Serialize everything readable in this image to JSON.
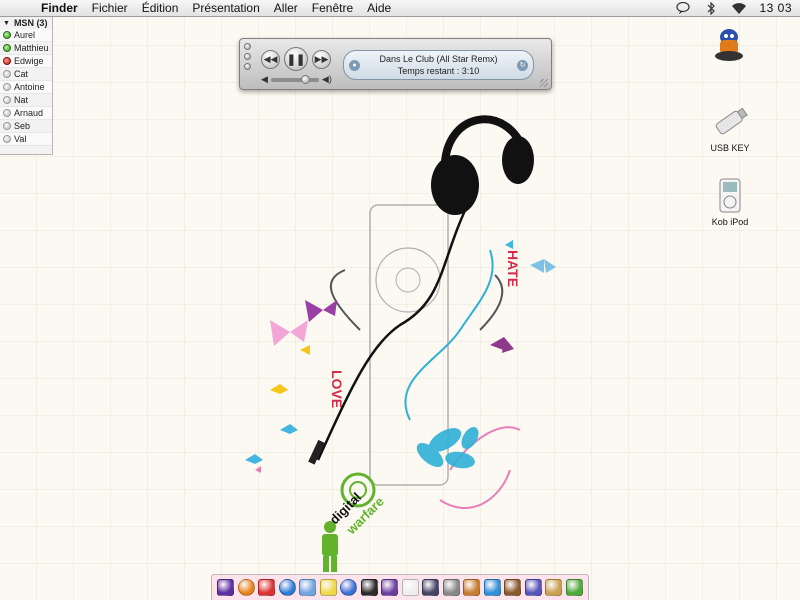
{
  "menubar": {
    "apple_glyph": "",
    "app_name": "Finder",
    "menus": [
      "Fichier",
      "Édition",
      "Présentation",
      "Aller",
      "Fenêtre",
      "Aide"
    ],
    "clock": "13 03",
    "status_icons": [
      "ichat-icon",
      "bluetooth-icon",
      "wifi-icon"
    ]
  },
  "msn": {
    "header": "MSN (3)",
    "contacts": [
      {
        "name": "Aurel",
        "status": "online"
      },
      {
        "name": "Matthieu",
        "status": "online"
      },
      {
        "name": "Edwige",
        "status": "busy"
      },
      {
        "name": "Cat",
        "status": "offline"
      },
      {
        "name": "Antoine",
        "status": "offline"
      },
      {
        "name": "Nat",
        "status": "offline"
      },
      {
        "name": "Arnaud",
        "status": "offline"
      },
      {
        "name": "Seb",
        "status": "offline"
      },
      {
        "name": "Val",
        "status": "offline"
      }
    ]
  },
  "player": {
    "track_title": "Dans Le Club (All Star Remx)",
    "time_label": "Temps restant : 3:10",
    "volume": 0.7
  },
  "desktop": {
    "icons": [
      {
        "name": "",
        "icon": "hard-drive-icon"
      },
      {
        "name": "USB KEY",
        "icon": "usb-key-icon"
      },
      {
        "name": "Kob iPod",
        "icon": "ipod-icon"
      }
    ]
  },
  "wallpaper": {
    "artwork_text": [
      "digital",
      "warfare",
      "LOVE",
      "HATE"
    ]
  },
  "dock": {
    "items": [
      "finder-icon",
      "firefox-icon",
      "ical-icon",
      "safari-icon",
      "mail-icon",
      "stickies-icon",
      "itunes-icon",
      "dashboard-icon",
      "preview-icon",
      "textedit-icon",
      "expose-icon",
      "calculator-icon",
      "photo-icon",
      "iphoto-icon",
      "chess-icon",
      "ichat-icon",
      "folder-icon",
      "trash-icon"
    ],
    "colors": [
      "#5a2fa0",
      "#e8841a",
      "#d33",
      "#2c7bd8",
      "#6fa6e0",
      "#f0d84a",
      "#3b6fd6",
      "#2b2b2b",
      "#6b3fa0",
      "#eee",
      "#446",
      "#888",
      "#c77d2e",
      "#2f8fd8",
      "#8a5a2b",
      "#55b",
      "#c9a24e",
      "#4caa3b"
    ]
  },
  "colors": {
    "wallpaper_bg": "#fbf9f2",
    "accent_cyan": "#2fb0d8",
    "accent_pink": "#e97fb8",
    "accent_green": "#63b22e"
  }
}
